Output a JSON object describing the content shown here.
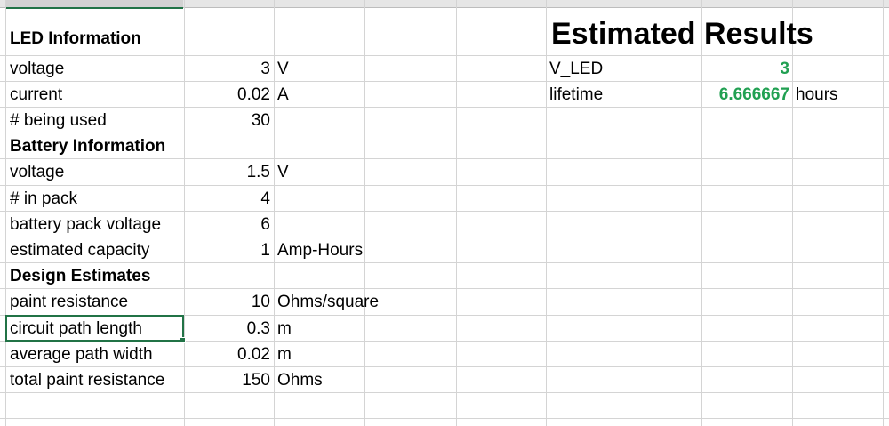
{
  "led": {
    "title": "LED Information",
    "rows": [
      {
        "label": "voltage",
        "value": "3",
        "unit": "V"
      },
      {
        "label": "current",
        "value": "0.02",
        "unit": "A"
      },
      {
        "label": "# being used",
        "value": "30",
        "unit": ""
      }
    ]
  },
  "battery": {
    "title": "Battery Information",
    "rows": [
      {
        "label": "voltage",
        "value": "1.5",
        "unit": "V"
      },
      {
        "label": "# in pack",
        "value": "4",
        "unit": ""
      },
      {
        "label": "battery pack voltage",
        "value": "6",
        "unit": ""
      },
      {
        "label": "estimated capacity",
        "value": "1",
        "unit": "Amp-Hours"
      }
    ]
  },
  "design": {
    "title": "Design Estimates",
    "rows": [
      {
        "label": "paint resistance",
        "value": "10",
        "unit": "Ohms/square"
      },
      {
        "label": "circuit path length",
        "value": "0.3",
        "unit": "m"
      },
      {
        "label": "average path width",
        "value": "0.02",
        "unit": "m"
      },
      {
        "label": "total paint resistance",
        "value": "150",
        "unit": "Ohms"
      }
    ]
  },
  "results": {
    "title": "Estimated Results",
    "rows": [
      {
        "label": "V_LED",
        "value": "3",
        "unit": ""
      },
      {
        "label": "lifetime",
        "value": "6.666667",
        "unit": "hours"
      }
    ]
  },
  "colors": {
    "result_value": "#21a052",
    "selection": "#217346",
    "gridline": "#d4d4d4"
  }
}
